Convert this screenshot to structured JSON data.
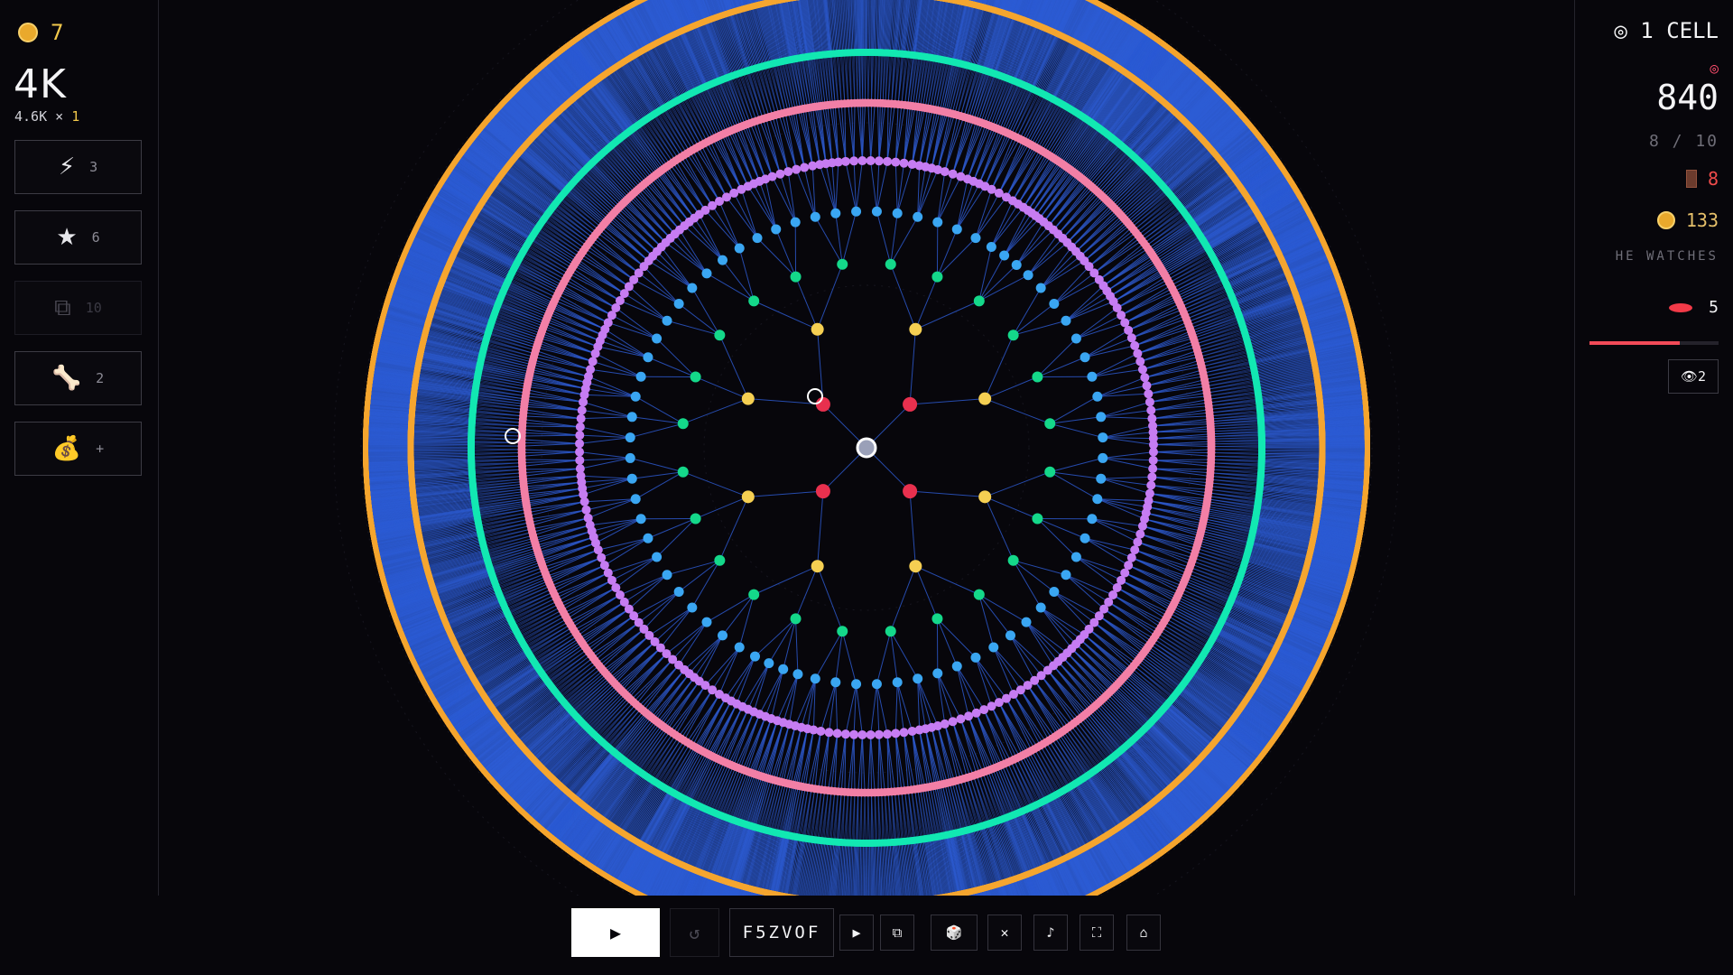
{
  "left": {
    "coins": "7",
    "score": "4K",
    "rate": "4.6K",
    "rate_sep": "×",
    "multiplier": "1",
    "tools": [
      {
        "name": "lightning-icon",
        "glyph": "⚡",
        "count": "3",
        "disabled": false
      },
      {
        "name": "star-icon",
        "glyph": "★",
        "count": "6",
        "disabled": false
      },
      {
        "name": "clone-icon",
        "glyph": "⧉",
        "count": "10",
        "disabled": true
      },
      {
        "name": "bone-icon",
        "glyph": "🦴",
        "count": "2",
        "disabled": false
      },
      {
        "name": "money-bag-icon",
        "glyph": "💰",
        "count": "+",
        "disabled": false
      }
    ]
  },
  "right": {
    "cells": "◎ 1 CELL",
    "target_glyph": "◎",
    "money": "840",
    "progress": "8 / 10",
    "doors": "8",
    "gold": "133",
    "watch_label": "HE WATCHES",
    "watch_count": "5",
    "danger_level": 0.7,
    "eye_label": "👁2"
  },
  "bottom": {
    "play_glyph": "▶",
    "reset_glyph": "↺",
    "seed": "F5ZVOF",
    "buttons": [
      {
        "name": "step-play-button",
        "glyph": "▶"
      },
      {
        "name": "copy-button",
        "glyph": "⧉"
      },
      {
        "name": "dice-button",
        "glyph": "🎲"
      },
      {
        "name": "close-button",
        "glyph": "✕"
      },
      {
        "name": "music-button",
        "glyph": "♪"
      },
      {
        "name": "fullscreen-button",
        "glyph": "⛶"
      },
      {
        "name": "home-button",
        "glyph": "⌂"
      }
    ]
  },
  "colors": {
    "background": "#07060b",
    "edge": "#2e5cd6",
    "ring_colors": [
      "#e8304e",
      "#f5cf52",
      "#14d88a",
      "#3aa6f2",
      "#c67cf2",
      "#f27fa6",
      "#12e8b2",
      "#f5a630"
    ],
    "selected": "#ffffff"
  }
}
